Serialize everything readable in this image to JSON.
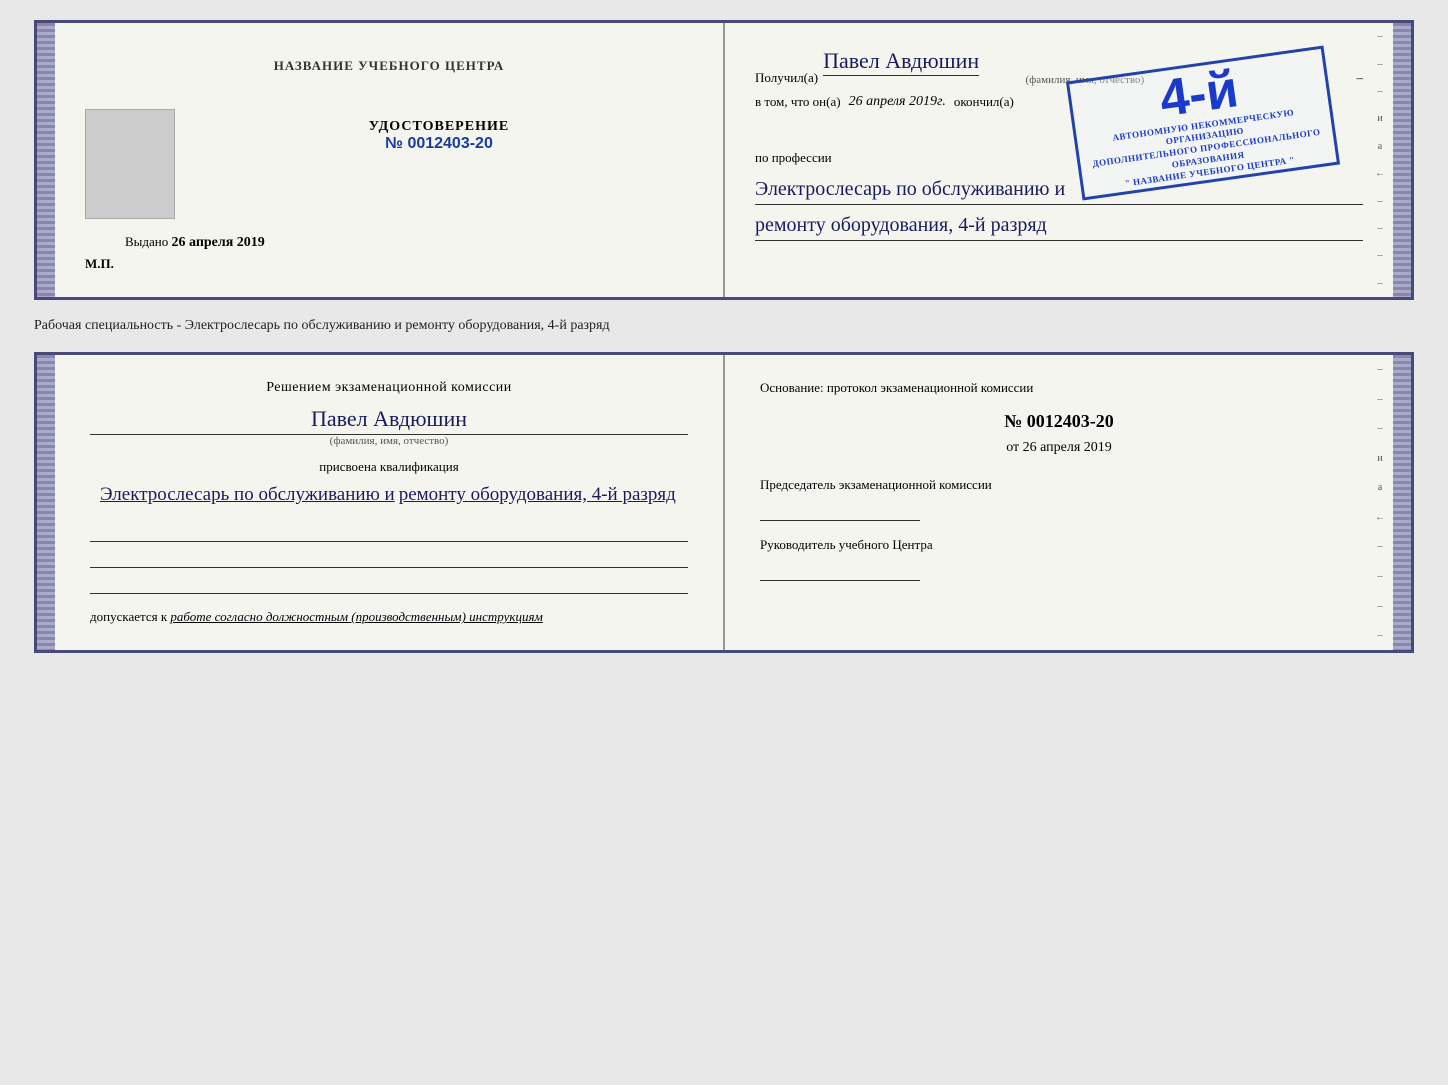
{
  "top_doc": {
    "left": {
      "title": "НАЗВАНИЕ УЧЕБНОГО ЦЕНТРА",
      "cert_label": "УДОСТОВЕРЕНИЕ",
      "cert_number_prefix": "№",
      "cert_number": "0012403-20",
      "issued_prefix": "Выдано",
      "issued_date": "26 апреля 2019",
      "mp_label": "М.П."
    },
    "right": {
      "received_prefix": "Получил(а)",
      "received_name": "Павел Авдюшин",
      "fio_label": "(фамилия, имя, отчество)",
      "vtom_prefix": "в том, что он(а)",
      "vtom_date": "26 апреля 2019г.",
      "finished_label": "окончил(а)",
      "stamp_grade": "4-й",
      "stamp_line1": "АВТОНОМНУЮ НЕКОММЕРЧЕСКУЮ ОРГАНИЗАЦИЮ",
      "stamp_line2": "ДОПОЛНИТЕЛЬНОГО ПРОФЕССИОНАЛЬНОГО ОБРАЗОВАНИЯ",
      "stamp_line3": "\" НАЗВАНИЕ УЧЕБНОГО ЦЕНТРА \"",
      "profession_prefix": "по профессии",
      "profession_line1": "Электрослесарь по обслуживанию и",
      "profession_line2": "ремонту оборудования, 4-й разряд"
    }
  },
  "middle": {
    "text": "Рабочая специальность - Электрослесарь по обслуживанию и ремонту оборудования, 4-й разряд"
  },
  "bottom_doc": {
    "left": {
      "komissia_title": "Решением экзаменационной комиссии",
      "person_name": "Павел Авдюшин",
      "fio_label": "(фамилия, имя, отчество)",
      "prisvoena": "присвоена квалификация",
      "kvalif_line1": "Электрослесарь по обслуживанию и",
      "kvalif_line2": "ремонту оборудования, 4-й разряд",
      "dopusk_prefix": "допускается к",
      "dopusk_italic": "работе согласно должностным (производственным) инструкциям"
    },
    "right": {
      "osnov_label": "Основание: протокол экзаменационной комиссии",
      "protocol_prefix": "№",
      "protocol_num": "0012403-20",
      "date_prefix": "от",
      "date_val": "26 апреля 2019",
      "chairman_label": "Председатель экзаменационной комиссии",
      "rukovod_label": "Руководитель учебного Центра"
    }
  },
  "deco": {
    "right_chars": [
      "и",
      "а",
      "←",
      "–",
      "–",
      "–",
      "–"
    ]
  }
}
